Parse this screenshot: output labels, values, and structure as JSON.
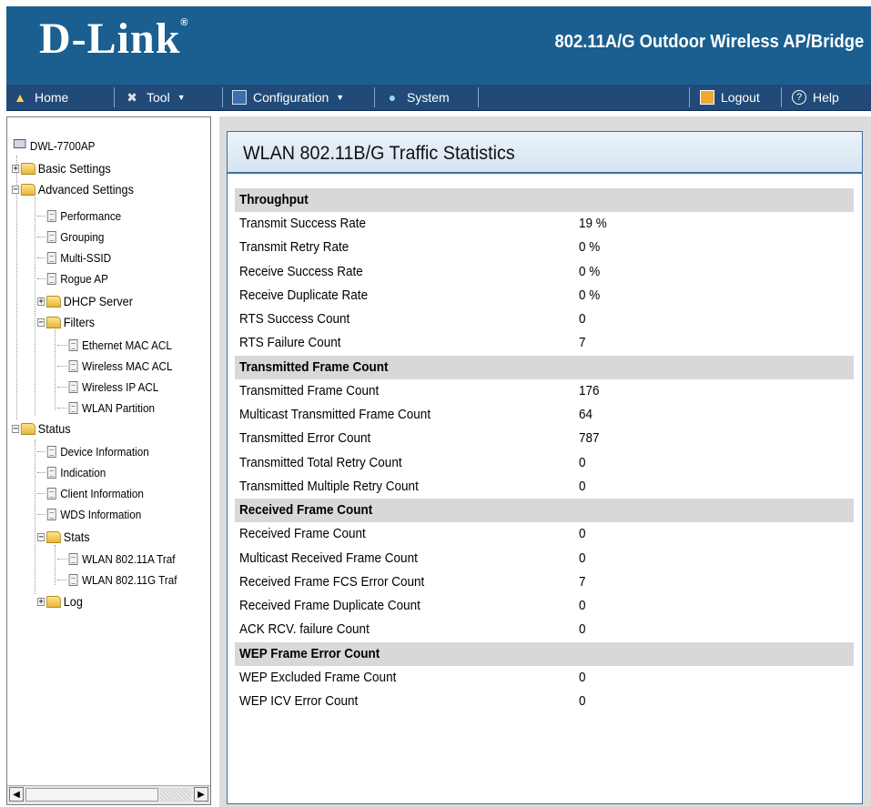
{
  "header": {
    "brand": "D-Link",
    "brand_mark": "®",
    "product_title": "802.11A/G Outdoor Wireless AP/Bridge"
  },
  "menubar": {
    "home": "Home",
    "tool": "Tool",
    "configuration": "Configuration",
    "system": "System",
    "logout": "Logout",
    "help": "Help"
  },
  "tree": {
    "root": "DWL-7700AP",
    "basic_settings": "Basic Settings",
    "advanced_settings": "Advanced Settings",
    "performance": "Performance",
    "grouping": "Grouping",
    "multi_ssid": "Multi-SSID",
    "rogue_ap": "Rogue AP",
    "dhcp_server": "DHCP Server",
    "filters": "Filters",
    "ethernet_mac_acl": "Ethernet MAC ACL",
    "wireless_mac_acl": "Wireless MAC ACL",
    "wireless_ip_acl": "Wireless IP ACL",
    "wlan_partition": "WLAN Partition",
    "status": "Status",
    "device_information": "Device Information",
    "indication": "Indication",
    "client_information": "Client Information",
    "wds_information": "WDS Information",
    "stats": "Stats",
    "wlan_11a_traffic": "WLAN 802.11A Traf",
    "wlan_11g_traffic": "WLAN 802.11G Traf",
    "log": "Log"
  },
  "panel": {
    "title": "WLAN 802.11B/G Traffic Statistics"
  },
  "stats": {
    "throughput": {
      "heading": "Throughput",
      "rows": [
        {
          "label": "Transmit Success Rate",
          "value": "19  %"
        },
        {
          "label": "Transmit Retry Rate",
          "value": "0  %"
        },
        {
          "label": "Receive Success Rate",
          "value": "0  %"
        },
        {
          "label": "Receive Duplicate Rate",
          "value": "0  %"
        },
        {
          "label": "RTS Success Count",
          "value": "0"
        },
        {
          "label": "RTS Failure Count",
          "value": "7"
        }
      ]
    },
    "transmitted": {
      "heading": "Transmitted Frame Count",
      "rows": [
        {
          "label": "Transmitted Frame Count",
          "value": "176"
        },
        {
          "label": "Multicast Transmitted Frame Count",
          "value": "64"
        },
        {
          "label": "Transmitted Error Count",
          "value": "787"
        },
        {
          "label": "Transmitted Total Retry Count",
          "value": "0"
        },
        {
          "label": "Transmitted Multiple Retry Count",
          "value": "0"
        }
      ]
    },
    "received": {
      "heading": "Received Frame Count",
      "rows": [
        {
          "label": "Received Frame Count",
          "value": "0"
        },
        {
          "label": "Multicast Received Frame Count",
          "value": "0"
        },
        {
          "label": "Received Frame FCS Error Count",
          "value": "7"
        },
        {
          "label": "Received Frame Duplicate Count",
          "value": "0"
        },
        {
          "label": "ACK RCV. failure Count",
          "value": "0"
        }
      ]
    },
    "wep": {
      "heading": "WEP Frame Error Count",
      "rows": [
        {
          "label": "WEP Excluded Frame Count",
          "value": "0"
        },
        {
          "label": "WEP ICV Error Count",
          "value": "0"
        }
      ]
    }
  }
}
